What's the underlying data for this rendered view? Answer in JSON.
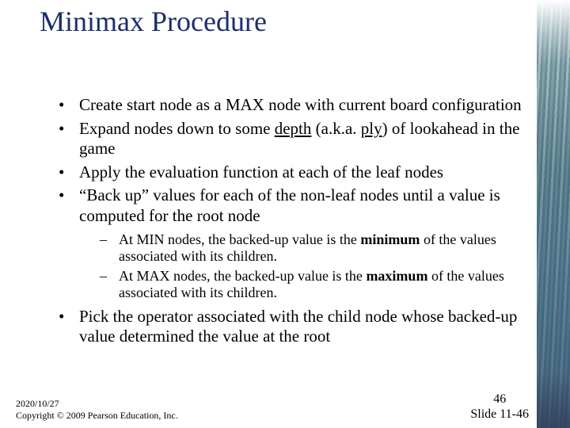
{
  "slide": {
    "title": "Minimax Procedure",
    "bullets": {
      "b1": "Create start node as a MAX node  with current board configuration",
      "b2_a": "Expand nodes down to some ",
      "b2_depth": "depth",
      "b2_b": " (a.k.a. ",
      "b2_ply": "ply",
      "b2_c": ") of lookahead in the game",
      "b3": "Apply the evaluation function at each of the leaf nodes",
      "b4": "“Back up” values for each of the non-leaf nodes until a value is computed for the root node",
      "s1_a": "At MIN nodes, the backed-up value is the ",
      "s1_min": "minimum",
      "s1_b": " of the values associated with its children.",
      "s2_a": "At MAX nodes, the backed-up value is the ",
      "s2_max": "maximum",
      "s2_b": " of the values associated with its children.",
      "b5": "Pick the operator associated with the child node whose backed-up value determined the value at the root"
    },
    "footer": {
      "date": "2020/10/27",
      "copyright": "Copyright © 2009 Pearson Education, Inc.",
      "page_number": "46",
      "slide_ref": "Slide 11-46"
    }
  }
}
